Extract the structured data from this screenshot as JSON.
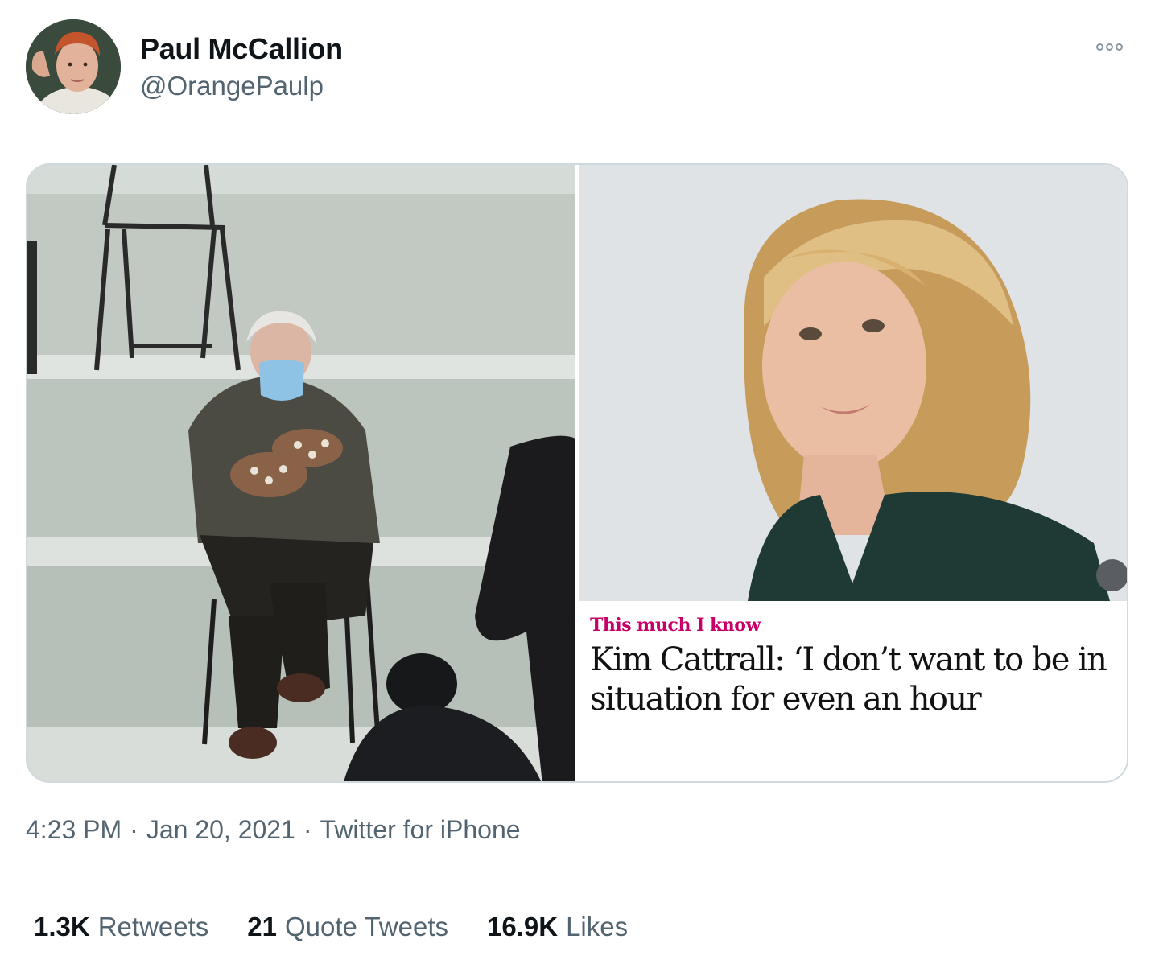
{
  "tweet": {
    "author": {
      "display_name": "Paul McCallion",
      "handle": "@OrangePaulp"
    },
    "more_icon": "more-horizontal-icon",
    "media": {
      "left_image": "photo-seated-man-in-mittens",
      "right_card": {
        "kicker": "This much I know",
        "headline": "Kim Cattrall: ‘I don’t want to be in\nsituation for even an hour"
      }
    },
    "meta": {
      "time": "4:23 PM",
      "dot1": "·",
      "date": "Jan 20, 2021",
      "dot2": "·",
      "source": "Twitter for iPhone"
    },
    "stats": {
      "retweets": {
        "count": "1.3K",
        "label": "Retweets"
      },
      "quote_tweets": {
        "count": "21",
        "label": "Quote Tweets"
      },
      "likes": {
        "count": "16.9K",
        "label": "Likes"
      }
    }
  }
}
